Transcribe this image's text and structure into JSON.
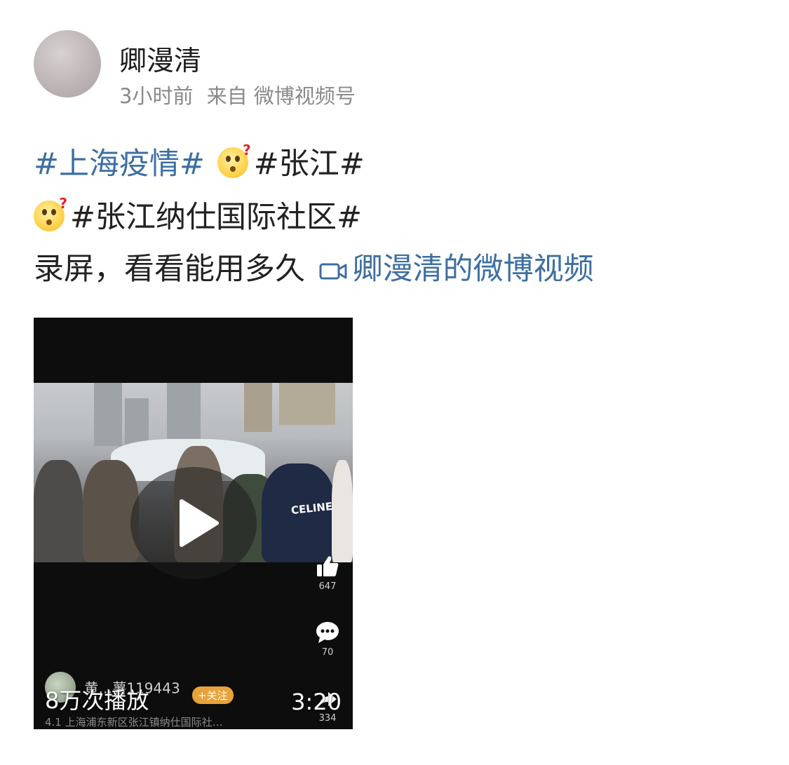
{
  "post": {
    "username": "卿漫清",
    "time": "3小时前",
    "source": "来自 微博视频号",
    "topic1": "#上海疫情#",
    "topic2": "#张江#",
    "topic3": "#张江纳仕国际社区#",
    "text": "录屏，看看能用多久",
    "video_link": "卿漫清的微博视频"
  },
  "video": {
    "play_count": "8万次播放",
    "duration": "3:20",
    "likes": "647",
    "comments": "70",
    "shares": "334",
    "author": "黄…薯119443",
    "follow_label": "+关注",
    "caption": "4.1 上海浦东新区张江镇纳仕国际社…",
    "jacket_text": "CELINE"
  }
}
